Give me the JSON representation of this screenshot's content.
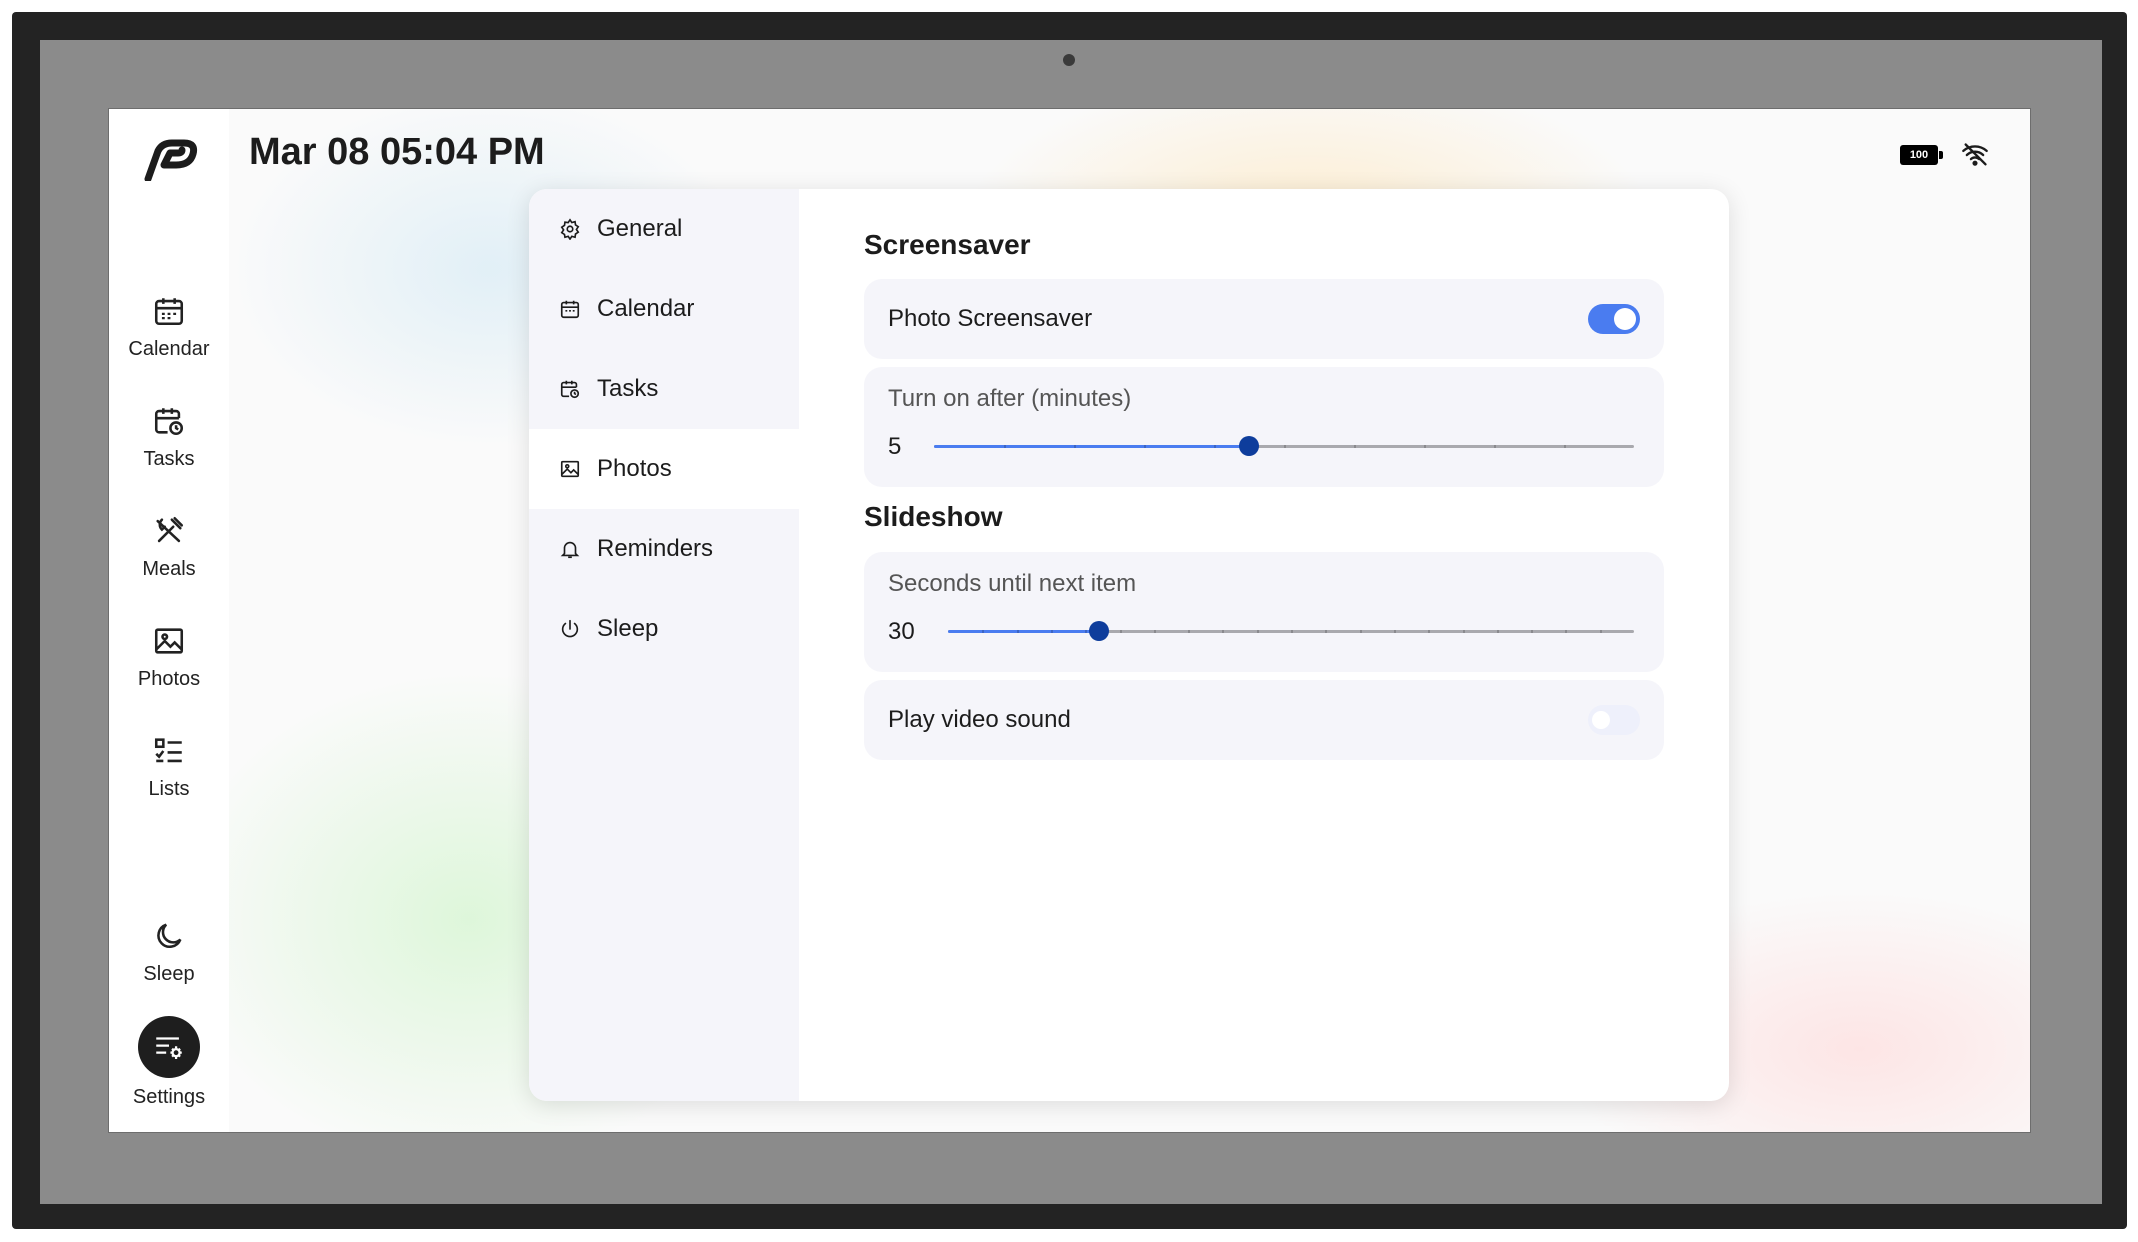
{
  "header": {
    "datetime": "Mar 08 05:04 PM"
  },
  "status": {
    "battery": "100",
    "wifi_icon": "wifi-off-icon"
  },
  "sidebar": {
    "items": [
      {
        "label": "Calendar",
        "icon": "calendar-icon"
      },
      {
        "label": "Tasks",
        "icon": "tasks-icon"
      },
      {
        "label": "Meals",
        "icon": "utensils-icon"
      },
      {
        "label": "Photos",
        "icon": "image-icon"
      },
      {
        "label": "Lists",
        "icon": "list-icon"
      }
    ],
    "sleep": {
      "label": "Sleep",
      "icon": "moon-icon"
    },
    "settings": {
      "label": "Settings",
      "icon": "settings-icon"
    }
  },
  "settings_menu": {
    "items": [
      {
        "label": "General",
        "icon": "gear-icon"
      },
      {
        "label": "Calendar",
        "icon": "calendar-icon"
      },
      {
        "label": "Tasks",
        "icon": "tasks-icon"
      },
      {
        "label": "Photos",
        "icon": "image-icon",
        "active": true
      },
      {
        "label": "Reminders",
        "icon": "bell-icon"
      },
      {
        "label": "Sleep",
        "icon": "power-icon"
      }
    ]
  },
  "screensaver": {
    "title": "Screensaver",
    "photo_screensaver": {
      "label": "Photo Screensaver",
      "enabled": true
    },
    "turn_on_after": {
      "label": "Turn on after (minutes)",
      "value": "5",
      "fraction": 0.45,
      "ticks": 10
    }
  },
  "slideshow": {
    "title": "Slideshow",
    "seconds_until_next": {
      "label": "Seconds until next item",
      "value": "30",
      "fraction": 0.22,
      "ticks": 20
    },
    "play_video_sound": {
      "label": "Play video sound",
      "enabled": false
    }
  },
  "colors": {
    "accent": "#4a7cf0",
    "thumb": "#0e3d9c",
    "card_bg": "#f5f5fa"
  }
}
